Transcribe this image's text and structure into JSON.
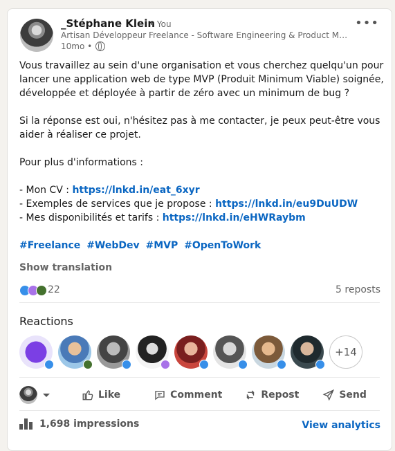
{
  "post": {
    "author": "_Stéphane Klein",
    "you_tag": "• You",
    "headline": "Artisan Développeur Freelance - Software Engineering & Product Manag...",
    "age": "10mo •",
    "visibility_icon": "globe-icon",
    "more_icon": "more-horizontal-icon",
    "body": {
      "p1": "Vous travaillez au sein d'une organisation et vous cherchez quelqu'un pour lancer une application web de type MVP (Produit Minimum Viable) soignée, développée et déployée à partir de zéro avec un minimum de bug ?",
      "p2": "Si la réponse est oui, n'hésitez pas à me contacter, je peux peut-être vous aider à réaliser ce projet.",
      "p3": "Pour plus d'informations :",
      "items": [
        {
          "label": "- Mon CV : ",
          "link": "https://lnkd.in/eat_6xyr"
        },
        {
          "label": "- Exemples de services que je propose : ",
          "link": "https://lnkd.in/eu9DuUDW"
        },
        {
          "label": "- Mes disponibilités et tarifs : ",
          "link": "https://lnkd.in/eHWRaybm"
        }
      ],
      "hashtags": [
        "#Freelance",
        "#WebDev",
        "#MVP",
        "#OpenToWork"
      ]
    },
    "show_translation": "Show translation"
  },
  "social": {
    "reaction_count": "22",
    "reposts": "5 reposts",
    "reactions_title": "Reactions",
    "more_reactors": "+14"
  },
  "actions": {
    "like": "Like",
    "comment": "Comment",
    "repost": "Repost",
    "send": "Send"
  },
  "stats": {
    "impressions": "1,698 impressions",
    "view_analytics": "View analytics"
  },
  "colors": {
    "link": "#0a66c2",
    "like": "#378fe9",
    "celebrate": "#a872e8",
    "support": "#44712e"
  }
}
